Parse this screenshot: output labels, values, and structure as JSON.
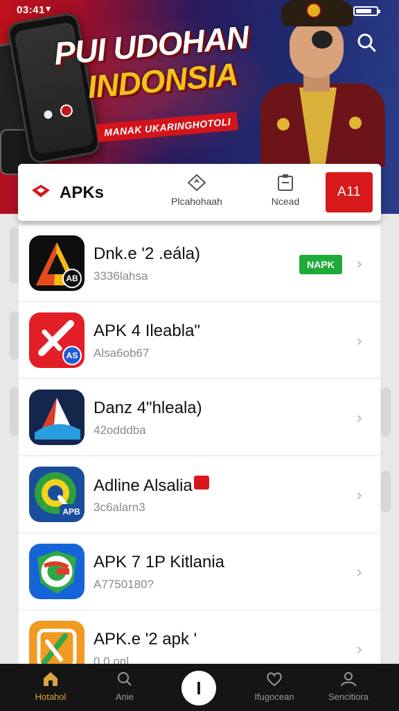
{
  "status_bar": {
    "time": "03:41"
  },
  "banner": {
    "headline_line1": "PUI UDOHAN",
    "headline_line2": "INDONSIA",
    "tagline": "MANAK UKARINGHOTOLI"
  },
  "header": {
    "title": "APKs",
    "nav": [
      {
        "label": "Plcahohaah",
        "icon": "diamond-icon"
      },
      {
        "label": "Ncead",
        "icon": "clipboard-icon"
      }
    ],
    "button_label": "A11"
  },
  "apps": [
    {
      "title": "Dnk.e '2 .eála)",
      "subtitle": "3336lahsa",
      "badge": "NAPK",
      "icon": "a-logo-yellow",
      "icon_badge": "AB"
    },
    {
      "title": "APK 4 Ileabla\"",
      "subtitle": "Alsa6ob67",
      "badge": "",
      "icon": "x-logo-red",
      "icon_badge": "AS"
    },
    {
      "title": "Danz 4\"hleala)",
      "subtitle": "42odddba",
      "badge": "",
      "icon": "a-logo-blue",
      "icon_badge": ""
    },
    {
      "title": "Adline Alsalia",
      "subtitle": "3c6alarn3",
      "badge": "",
      "icon": "q-logo-green",
      "icon_badge": "APB"
    },
    {
      "title": "APK 7 1P Kitlania",
      "subtitle": "A7750180?",
      "badge": "",
      "icon": "g-logo-blue",
      "icon_badge": ""
    },
    {
      "title": "APK.e '2 apk '",
      "subtitle": "0.0 onl",
      "badge": "",
      "icon": "x-logo-orange",
      "icon_badge": ""
    }
  ],
  "bottom_nav": {
    "tabs": [
      {
        "label": "Hotahol",
        "icon": "home-icon"
      },
      {
        "label": "Anie",
        "icon": "search-icon"
      },
      {
        "label": "I",
        "icon": "center-icon"
      },
      {
        "label": "Ifugocean",
        "icon": "heart-icon"
      },
      {
        "label": "Sencitiora",
        "icon": "profile-icon"
      }
    ]
  },
  "colors": {
    "accent_red": "#d7191b",
    "badge_green": "#1fab3b",
    "home_active": "#d9a53a"
  }
}
